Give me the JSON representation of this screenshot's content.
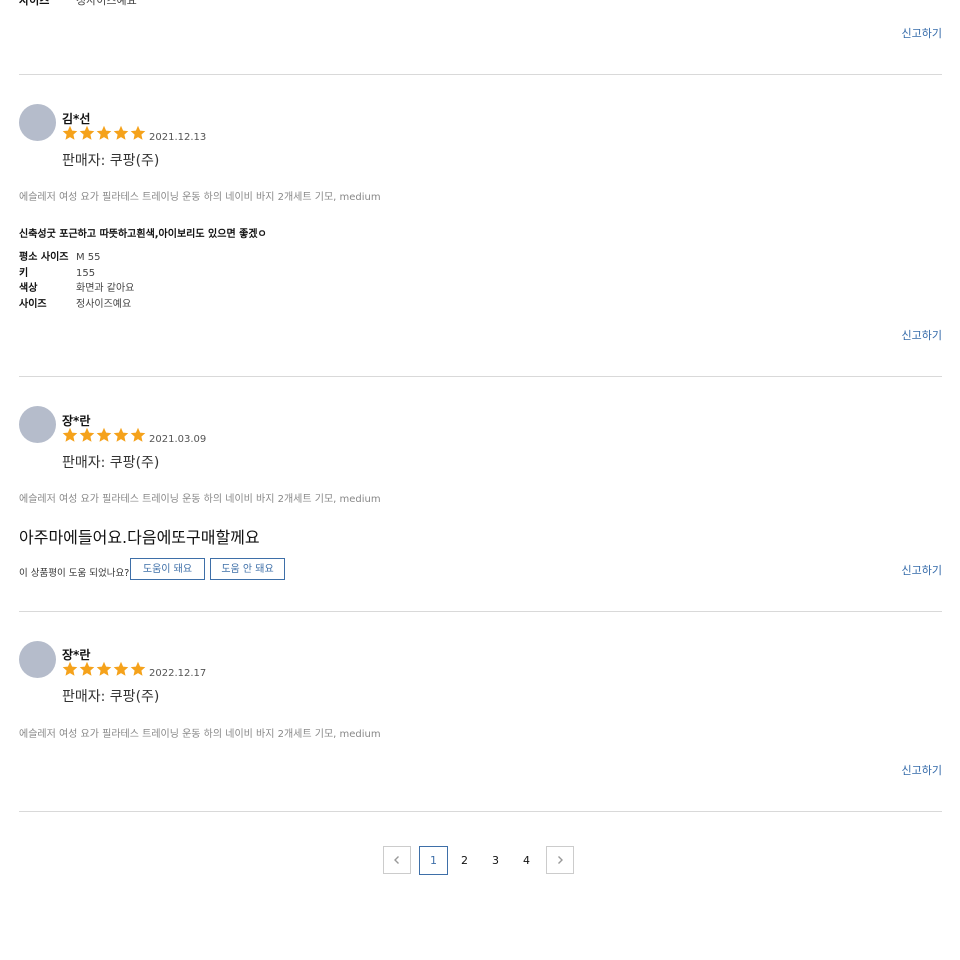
{
  "top_fragment": {
    "label": "사이즈",
    "value": "정사이즈예요",
    "report": "신고하기"
  },
  "reviews": [
    {
      "user": "김*선",
      "rating": 5,
      "date": "2021.12.13",
      "seller": "판매자: 쿠팡(주)",
      "product": "에슬레저 여성 요가 필라테스 트레이닝 운동 하의 네이비 바지 2개세트 기모, medium",
      "headline": "신축성굿 포근하고 따뜻하고흰색,아이보리도 있으면 좋겠ㅇ",
      "survey": [
        {
          "key": "평소 사이즈",
          "value": "M 55"
        },
        {
          "key": "키",
          "value": "155"
        },
        {
          "key": "색상",
          "value": "화면과 같아요"
        },
        {
          "key": "사이즈",
          "value": "정사이즈예요"
        }
      ],
      "report": "신고하기"
    },
    {
      "user": "장*란",
      "rating": 5,
      "date": "2021.03.09",
      "seller": "판매자: 쿠팡(주)",
      "product": "에슬레저 여성 요가 필라테스 트레이닝 운동 하의 네이비 바지 2개세트 기모, medium",
      "body": "아주마에들어요.다음에또구매할께요",
      "helpful_question": "이 상품평이 도움 되었나요?",
      "helpful_yes": "도움이 돼요",
      "helpful_no": "도움 안 돼요",
      "report": "신고하기"
    },
    {
      "user": "장*란",
      "rating": 5,
      "date": "2022.12.17",
      "seller": "판매자: 쿠팡(주)",
      "product": "에슬레저 여성 요가 필라테스 트레이닝 운동 하의 네이비 바지 2개세트 기모, medium",
      "report": "신고하기"
    }
  ],
  "pagination": {
    "pages": [
      "1",
      "2",
      "3",
      "4"
    ],
    "current": "1"
  },
  "colors": {
    "star": "#f5a21b",
    "accent": "#346aa9",
    "avatar": "#b5bccb",
    "divider": "#d9d9d9"
  },
  "icons": {
    "star": "star-icon",
    "prev": "chevron-left-icon",
    "next": "chevron-right-icon"
  }
}
